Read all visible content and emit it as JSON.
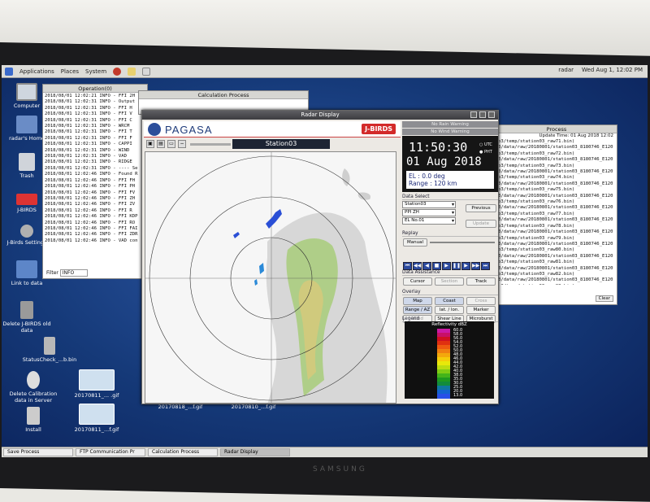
{
  "top_panel": {
    "menus": [
      "Applications",
      "Places",
      "System"
    ],
    "user": "radar",
    "clock": "Wed Aug 1, 12:02 PM"
  },
  "desktop_icons": [
    {
      "label": "Computer"
    },
    {
      "label": "radar's Home"
    },
    {
      "label": "Trash"
    },
    {
      "label": "J-BIRDS"
    },
    {
      "label": "J-Birds Settings"
    },
    {
      "label": "Link to data"
    },
    {
      "label": "Delete J-BIRDS old data"
    },
    {
      "label": "StatusCheck_...b.bin"
    },
    {
      "label": "Delete Calibration data in Server"
    },
    {
      "label": "Install"
    }
  ],
  "thumbnails": [
    "20170811_... .gif",
    "20170811_...f.gif",
    "20170818_...f.gif",
    "20170810_...f.gif"
  ],
  "operation_window": {
    "title": "Operation(0)",
    "filter_label": "Filter",
    "filter_value": "INFO",
    "lines": [
      "2018/08/01 12:02:21 INFO - FFI 2H",
      "2018/08/01 12:02:31 INFO - Output",
      "2018/08/01 12:02:31 INFO - FFI H",
      "2018/08/01 12:02:31 INFO - FFI V",
      "2018/08/01 12:02:31 INFO - FFI C",
      "2018/08/01 12:02:31 INFO - WRCM",
      "2018/08/01 12:02:31 INFO - FFI T",
      "2018/08/01 12:02:31 INFO - FFI F",
      "2018/08/01 12:02:31 INFO - CAPPI",
      "2018/08/01 12:02:31 INFO - WIND",
      "2018/08/01 12:02:31 INFO - VAD",
      "2018/08/01 12:02:31 INFO - RIDGE",
      "2018/08/01 12:02:31 INFO - ---- Se",
      "2018/08/01 12:02:46 INFO - Found R",
      "2018/08/01 12:02:46 INFO - FFI FH",
      "2018/08/01 12:02:46 INFO - FFI PH",
      "2018/08/01 12:02:46 INFO - FFI FV",
      "2018/08/01 12:02:46 INFO - FFI ZH",
      "2018/08/01 12:02:46 INFO - FFI ZV",
      "2018/08/01 12:02:46 INFO - FFI R",
      "2018/08/01 12:02:46 INFO - FFI KDP",
      "2018/08/01 12:02:46 INFO - FFI RO",
      "2018/08/01 12:02:46 INFO - FFI FAI",
      "2018/08/01 12:02:46 INFO - FFI ZDR",
      "2018/08/01 12:02:46 INFO - VAD con"
    ]
  },
  "calc_window": {
    "title": "Calculation Process"
  },
  "process_window": {
    "title": "Process",
    "update_time": "Update Time: 01 Aug 2018 12:02",
    "clear_label": "Clear",
    "lines": [
      "o3/temp/station03_raw71.bin)",
      "3/data/raw/20180801/station03_8180746_E120",
      "o3/temp/station03_raw72.bin)",
      "3/data/raw/20180801/station03_8180746_E120",
      "o3/temp/station03_raw73.bin)",
      "3/data/raw/20180801/station03_8180746_E120",
      "o3/temp/station03_raw74.bin)",
      "3/data/raw/20180801/station03_8180746_E120",
      "o3/temp/station03_raw75.bin)",
      "3/data/raw/20180801/station03_8180746_E120",
      "o3/temp/station03_raw76.bin)",
      "3/data/raw/20180801/station03_8180746_E120",
      "o3/temp/station03_raw77.bin)",
      "3/data/raw/20180801/station03_8180746_E120",
      "o3/temp/station03_raw78.bin)",
      "3/data/raw/20180801/station03_8180746_E120",
      "o3/temp/station03_raw79.bin)",
      "3/data/raw/20180801/station03_8180746_E120",
      "o3/temp/station03_raw80.bin)",
      "3/data/raw/20180801/station03_8180746_E120",
      "o3/temp/station03_raw81.bin)",
      "3/data/raw/20180801/station03_8180746_E120",
      "o3/temp/station03_raw82.bin)",
      "3/data/raw/20180801/station03_8180746_E120",
      "o3/temp/station03_raw83.bin)",
      "3/data/raw/20180801/station03_8180746_E120"
    ]
  },
  "radar_display": {
    "title": "Radar Display",
    "brand": "PAGASA",
    "jbirds_logo": "J-BIRDS",
    "station": "Station03",
    "warnings": [
      "No Rain Warning",
      "No Wind Warning"
    ],
    "time": "11:50:30",
    "date": "01 Aug 2018",
    "tz_utc": "UTC",
    "tz_pht": "PHT",
    "el": "EL : 0.0 deg",
    "range": "Range : 120 km",
    "data_select_label": "Data Select",
    "station_select": "Station03",
    "product_select": "PPI ZH",
    "el_select": "EL No.01",
    "previous_label": "Previous",
    "update_label": "Update",
    "replay_label": "Replay",
    "manual_label": "Manual",
    "assistance_label": "Data Assistance",
    "cursor_label": "Cursor",
    "section_label": "Section",
    "track_label": "Track",
    "overlay_label": "Overlay",
    "overlay_buttons": [
      "Map",
      "Coast",
      "Cross",
      "Range / AZ",
      "lat. / lon.",
      "Marker",
      "Wind",
      "Shear Line",
      "Microburst"
    ],
    "legend_label": "Legend",
    "legend_title": "Reflectivity dBZ",
    "legend_values": [
      "60.0",
      "58.0",
      "56.0",
      "54.0",
      "52.0",
      "50.0",
      "48.0",
      "46.0",
      "44.0",
      "42.0",
      "40.0",
      "38.0",
      "35.0",
      "30.0",
      "25.0",
      "20.0",
      "13.0"
    ],
    "legend_colors": [
      "#cc1aa4",
      "#c81066",
      "#d01020",
      "#e03010",
      "#ee5a10",
      "#f08010",
      "#f3a80c",
      "#f5cc0a",
      "#e8e80a",
      "#bcdc10",
      "#80cc14",
      "#44b41a",
      "#1e9a20",
      "#128c3c",
      "#1078a0",
      "#1464d0",
      "#2850e8"
    ]
  },
  "taskbar": {
    "items": [
      "Save Process",
      "FTP Communication Pr",
      "Calculation Process",
      "Radar Display"
    ]
  },
  "monitor_brand": "SAMSUNG"
}
